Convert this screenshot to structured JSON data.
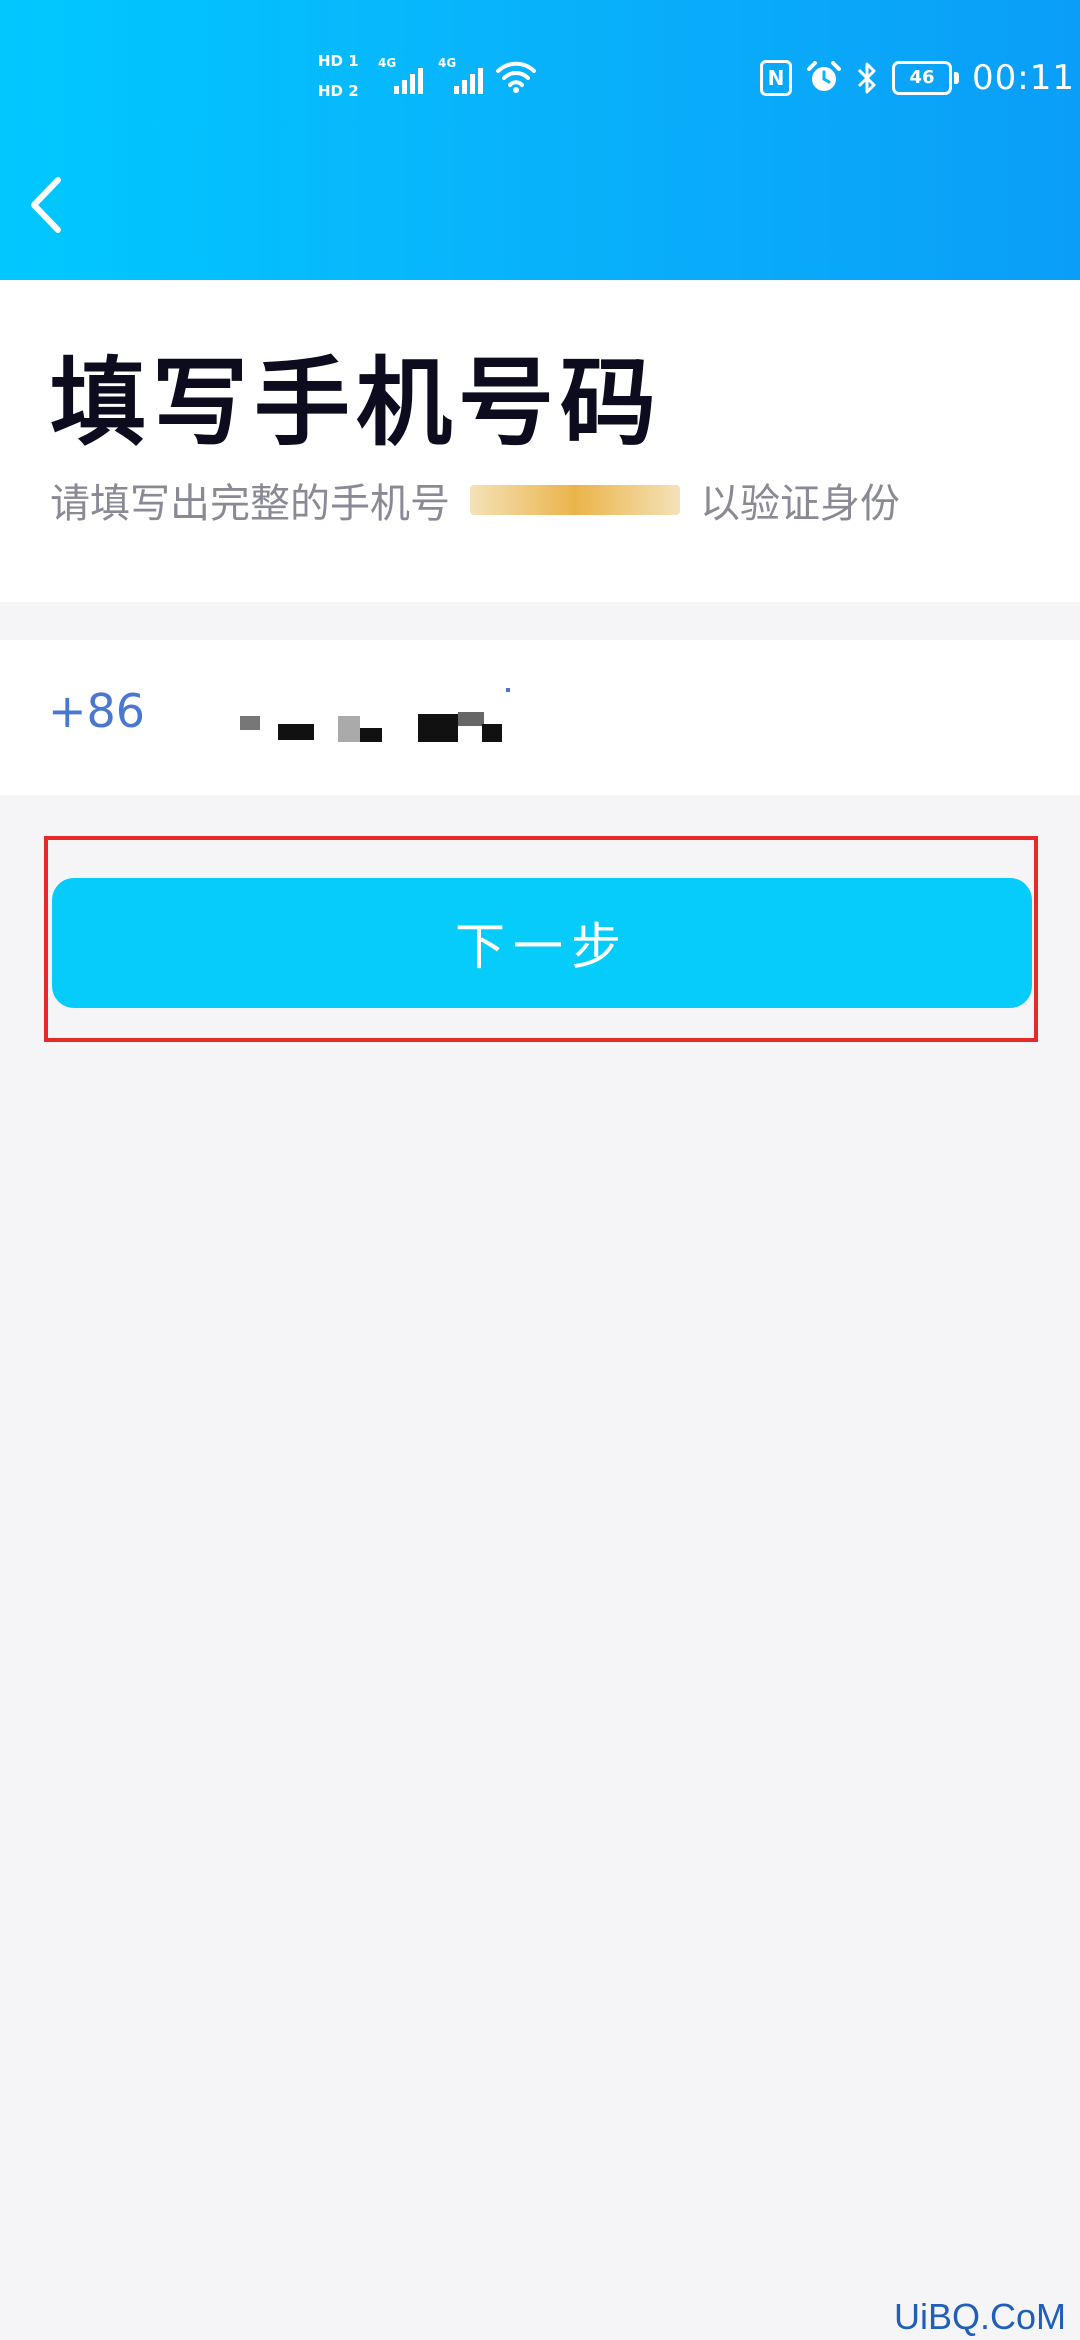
{
  "status_bar": {
    "sim_badges": [
      "HD 1",
      "HD 2"
    ],
    "network_tags": [
      "4G",
      "4G"
    ],
    "battery_level": "46",
    "time": "00:11",
    "icons": [
      "nfc-icon",
      "alarm-icon",
      "bluetooth-icon",
      "wifi-icon",
      "signal-icon"
    ]
  },
  "header": {
    "back_icon": "chevron-left-icon"
  },
  "main": {
    "title": "填写手机号码",
    "subtitle_prefix": "请填写出完整的手机号",
    "subtitle_suffix": "以验证身份"
  },
  "phone_form": {
    "country_code": "+86"
  },
  "actions": {
    "next_label": "下一步"
  },
  "colors": {
    "header_start": "#00c8ff",
    "header_end": "#0a9ef8",
    "button": "#06ccfc",
    "highlight": "#e52a2a",
    "country_code": "#4a78d0"
  },
  "watermark": "UiBQ.CoM"
}
